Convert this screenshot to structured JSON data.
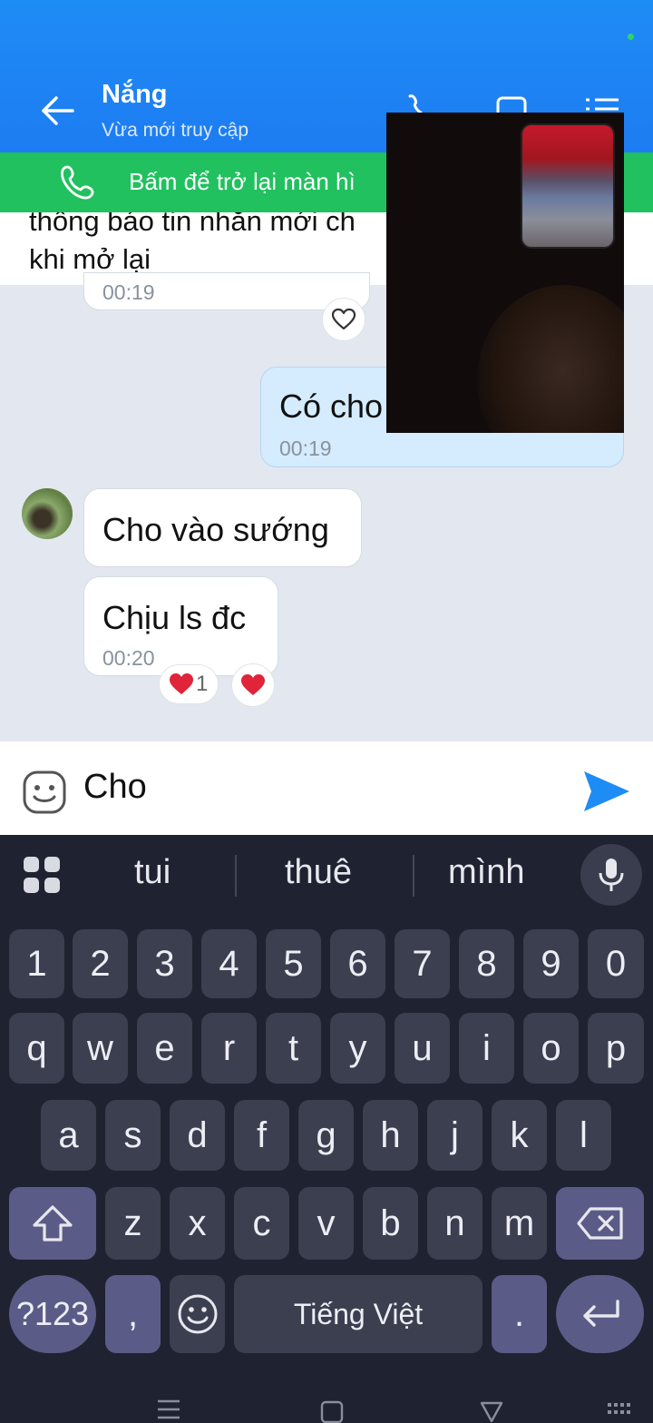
{
  "header": {
    "contact_name": "Nắng",
    "contact_status": "Vừa mới truy cập",
    "back_icon": "arrow-left-icon",
    "icons": [
      "phone-icon",
      "video-camera-icon",
      "list-menu-icon"
    ]
  },
  "call_banner": {
    "text": "Bấm để trở lại màn hì",
    "icon": "phone-icon",
    "color": "#20c15e"
  },
  "notice": {
    "line1": "thông báo tin nhắn mới ch",
    "line2": "khi mở lại"
  },
  "messages": [
    {
      "direction": "in",
      "time": "00:19"
    },
    {
      "direction": "out",
      "text": "Có cho",
      "time": "00:19"
    },
    {
      "direction": "in",
      "text": "Cho vào sướng"
    },
    {
      "direction": "in",
      "text": "Chịu ls đc",
      "time": "00:20",
      "reaction_count": "1"
    }
  ],
  "composer": {
    "value": "Cho",
    "emoji_icon": "sticker-smile-icon",
    "send_icon": "send-icon"
  },
  "keyboard": {
    "suggestions": [
      "tui",
      "thuê",
      "mình"
    ],
    "numbers": [
      "1",
      "2",
      "3",
      "4",
      "5",
      "6",
      "7",
      "8",
      "9",
      "0"
    ],
    "row1": [
      "q",
      "w",
      "e",
      "r",
      "t",
      "y",
      "u",
      "i",
      "o",
      "p"
    ],
    "row2": [
      "a",
      "s",
      "d",
      "f",
      "g",
      "h",
      "j",
      "k",
      "l"
    ],
    "row3": [
      "z",
      "x",
      "c",
      "v",
      "b",
      "n",
      "m"
    ],
    "sym_label": "?123",
    "comma": ",",
    "space_label": "Tiếng Việt",
    "period": "."
  },
  "colors": {
    "header": "#1d7cf2",
    "keyboard_bg": "#1f2230",
    "accent_send": "#1e8cf5",
    "heart": "#e0243a"
  }
}
